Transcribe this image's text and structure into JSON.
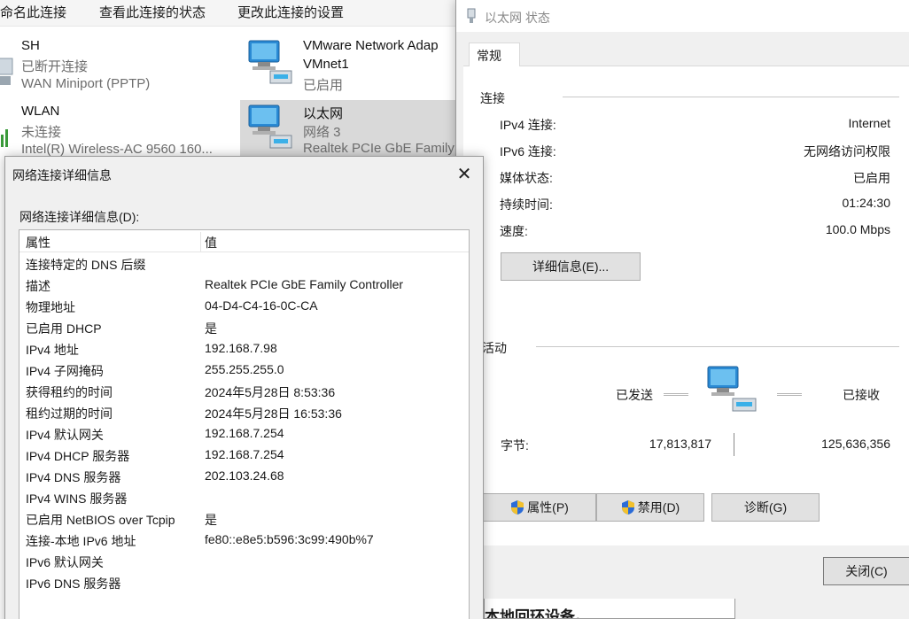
{
  "toolbar": {
    "rename": "命名此连接",
    "view_status": "查看此连接的状态",
    "change_settings": "更改此连接的设置"
  },
  "connections": [
    {
      "name": "SH",
      "status": "已断开连接",
      "device": "WAN Miniport (PPTP)"
    },
    {
      "name": "VMware Network Adap",
      "status": "VMnet1",
      "device": "已启用"
    },
    {
      "name": "WLAN",
      "status": "未连接",
      "device": "Intel(R) Wireless-AC 9560 160..."
    },
    {
      "name": "以太网",
      "status": "网络 3",
      "device": "Realtek PCIe GbE Family"
    }
  ],
  "status_window": {
    "title": "以太网 状态",
    "tab": "常规",
    "connection_group": "连接",
    "rows": [
      {
        "label": "IPv4 连接:",
        "value": "Internet"
      },
      {
        "label": "IPv6 连接:",
        "value": "无网络访问权限"
      },
      {
        "label": "媒体状态:",
        "value": "已启用"
      },
      {
        "label": "持续时间:",
        "value": "01:24:30"
      },
      {
        "label": "速度:",
        "value": "100.0 Mbps"
      }
    ],
    "details_button": "详细信息(E)...",
    "activity_group": "活动",
    "sent_label": "已发送",
    "received_label": "已接收",
    "bytes_label": "字节:",
    "bytes_sent": "17,813,817",
    "bytes_received": "125,636,356",
    "properties_button": "属性(P)",
    "disable_button": "禁用(D)",
    "diagnose_button": "诊断(G)",
    "close_button": "关闭(C)"
  },
  "details_dialog": {
    "title": "网络连接详细信息",
    "list_label": "网络连接详细信息(D):",
    "col_property": "属性",
    "col_value": "值",
    "rows": [
      {
        "p": "连接特定的 DNS 后缀",
        "v": ""
      },
      {
        "p": "描述",
        "v": "Realtek PCIe GbE Family Controller"
      },
      {
        "p": "物理地址",
        "v": "04-D4-C4-16-0C-CA"
      },
      {
        "p": "已启用 DHCP",
        "v": "是"
      },
      {
        "p": "IPv4 地址",
        "v": "192.168.7.98"
      },
      {
        "p": "IPv4 子网掩码",
        "v": "255.255.255.0"
      },
      {
        "p": "获得租约的时间",
        "v": "2024年5月28日 8:53:36"
      },
      {
        "p": "租约过期的时间",
        "v": "2024年5月28日 16:53:36"
      },
      {
        "p": "IPv4 默认网关",
        "v": "192.168.7.254"
      },
      {
        "p": "IPv4 DHCP 服务器",
        "v": "192.168.7.254"
      },
      {
        "p": "IPv4 DNS 服务器",
        "v": "202.103.24.68"
      },
      {
        "p": "IPv4 WINS 服务器",
        "v": ""
      },
      {
        "p": "已启用 NetBIOS over Tcpip",
        "v": "是"
      },
      {
        "p": "连接-本地 IPv6 地址",
        "v": "fe80::e8e5:b596:3c99:490b%7"
      },
      {
        "p": "IPv6 默认网关",
        "v": ""
      },
      {
        "p": "IPv6 DNS 服务器",
        "v": ""
      }
    ]
  },
  "background_partial_text": "本地回环设备。",
  "colors": {
    "selection": "#d9d9d9",
    "window_bg": "#f0f0f0",
    "button_bg": "#e1e1e1",
    "accent_blue": "#1e8ad2",
    "shield_blue": "#2b6cd8",
    "shield_yellow": "#f2c12e"
  }
}
